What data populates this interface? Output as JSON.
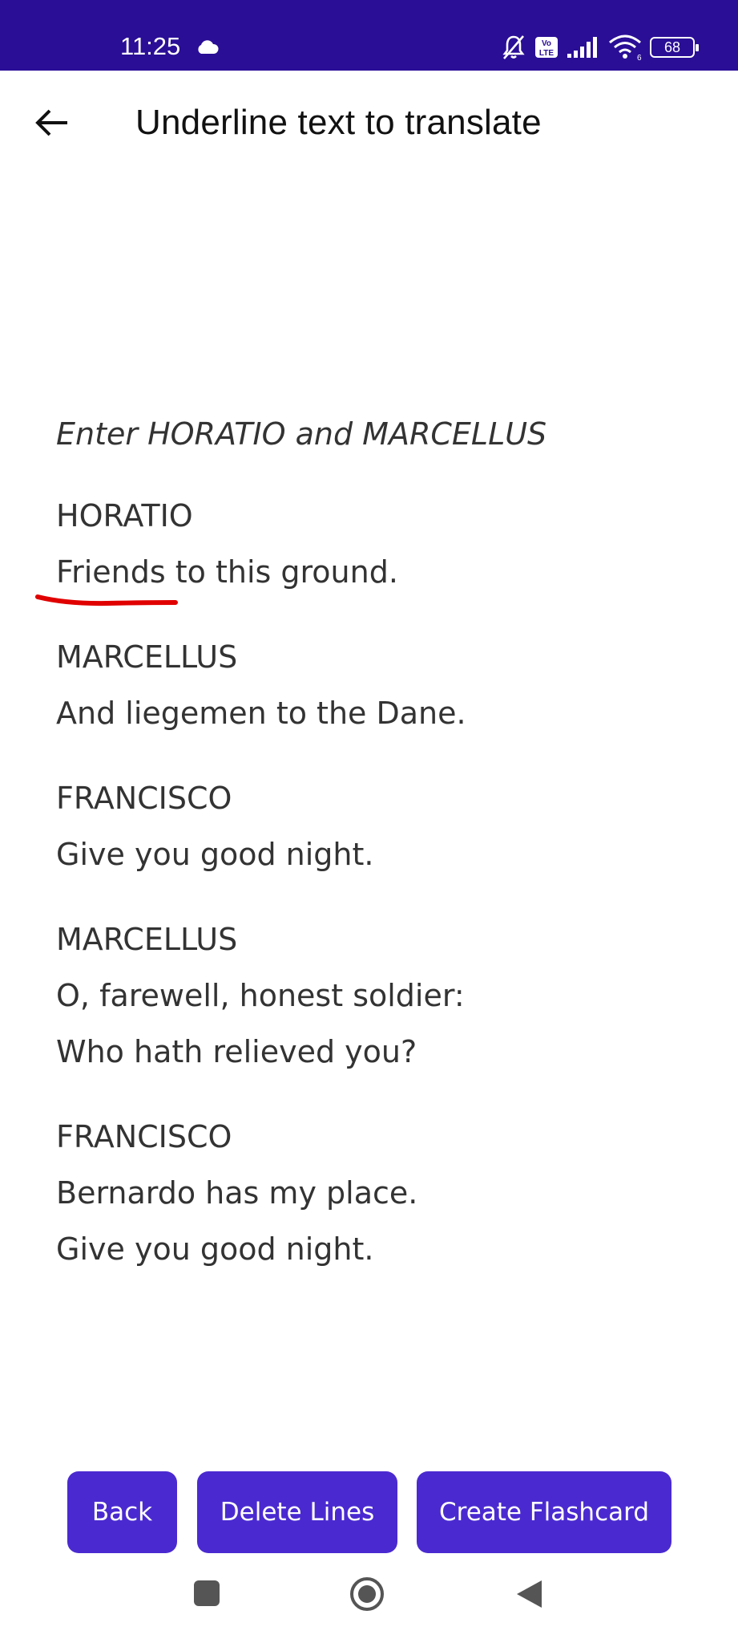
{
  "status_bar": {
    "time": "11:25",
    "battery": "68",
    "icons": [
      "cloud-icon",
      "mute-icon",
      "volte-icon",
      "signal-icon",
      "wifi-icon",
      "battery-icon"
    ],
    "volte_label": "Vo LTE",
    "wifi_band": "6",
    "background": "#2a0e96"
  },
  "app_bar": {
    "title": "Underline text to translate",
    "back_icon": "back-arrow-icon"
  },
  "script": {
    "stage_direction": "Enter HORATIO and MARCELLUS",
    "blocks": [
      {
        "speaker": "HORATIO",
        "lines": [
          "Friends to this ground."
        ]
      },
      {
        "speaker": "MARCELLUS",
        "lines": [
          "And liegemen to the Dane."
        ]
      },
      {
        "speaker": "FRANCISCO",
        "lines": [
          "Give you good night."
        ]
      },
      {
        "speaker": "MARCELLUS",
        "lines": [
          "O, farewell, honest soldier:",
          "Who hath relieved you?"
        ]
      },
      {
        "speaker": "FRANCISCO",
        "lines": [
          "Bernardo has my place.",
          "Give you good night."
        ]
      }
    ],
    "underline_color": "#e00000"
  },
  "buttons": {
    "back": "Back",
    "delete_lines": "Delete Lines",
    "create_flashcard": "Create Flashcard",
    "color": "#4a2ad0"
  },
  "nav_bar": {
    "icons": [
      "recents-square-icon",
      "home-circle-icon",
      "back-triangle-icon"
    ]
  }
}
